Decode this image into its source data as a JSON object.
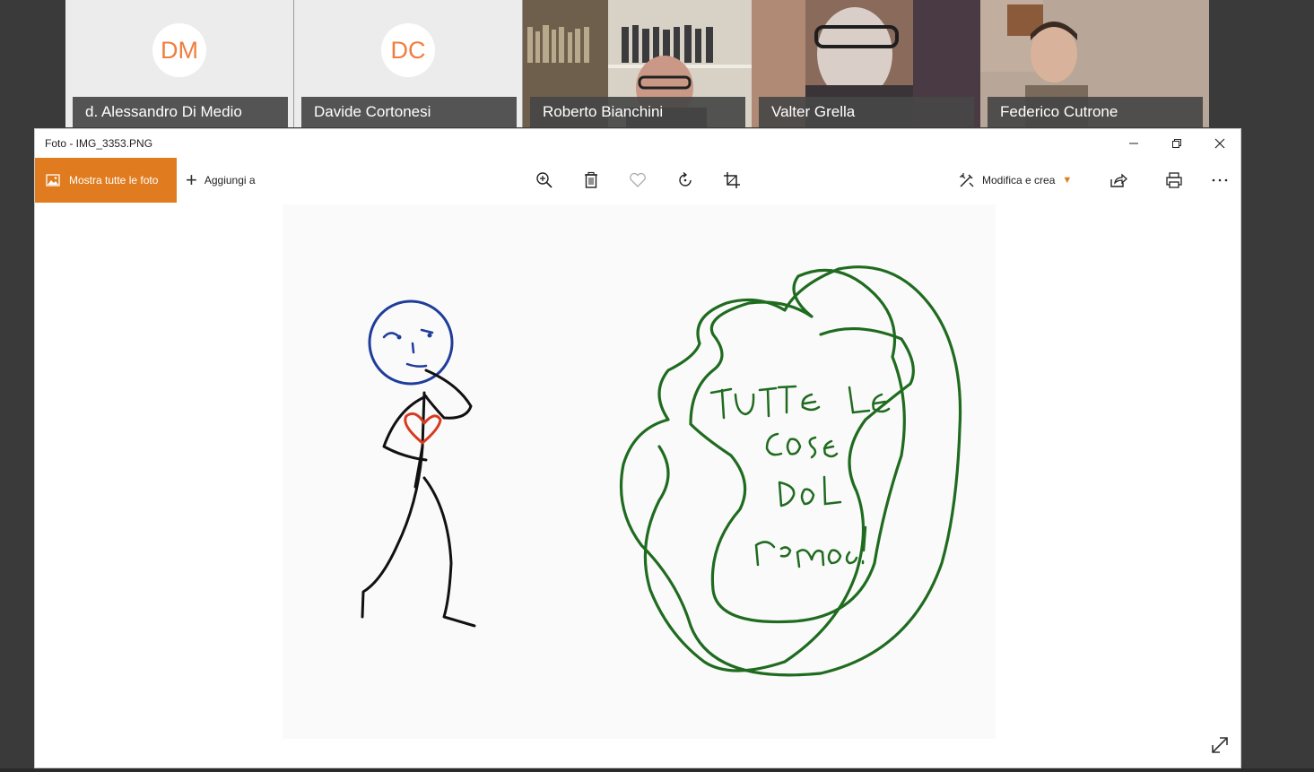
{
  "participants": [
    {
      "initials": "DM",
      "name": "d. Alessandro Di Medio",
      "type": "avatar"
    },
    {
      "initials": "DC",
      "name": "Davide Cortonesi",
      "type": "avatar"
    },
    {
      "name": "Roberto Bianchini",
      "type": "video"
    },
    {
      "name": "Valter Grella",
      "type": "video"
    },
    {
      "name": "Federico Cutrone",
      "type": "video"
    }
  ],
  "window": {
    "title": "Foto - IMG_3353.PNG"
  },
  "toolbar": {
    "show_all_label": "Mostra tutte le foto",
    "add_label": "Aggiungi a",
    "edit_label": "Modifica e crea"
  },
  "icons": {
    "accent": "#e07c1f",
    "avatar_text": "#f07d3e",
    "drawing_green": "#1f6b1f",
    "drawing_blue": "#1f3d9a",
    "drawing_red": "#d93a1f"
  },
  "drawing": {
    "handwritten_text": "TUTTE LE COSE DEL MONDO!"
  }
}
